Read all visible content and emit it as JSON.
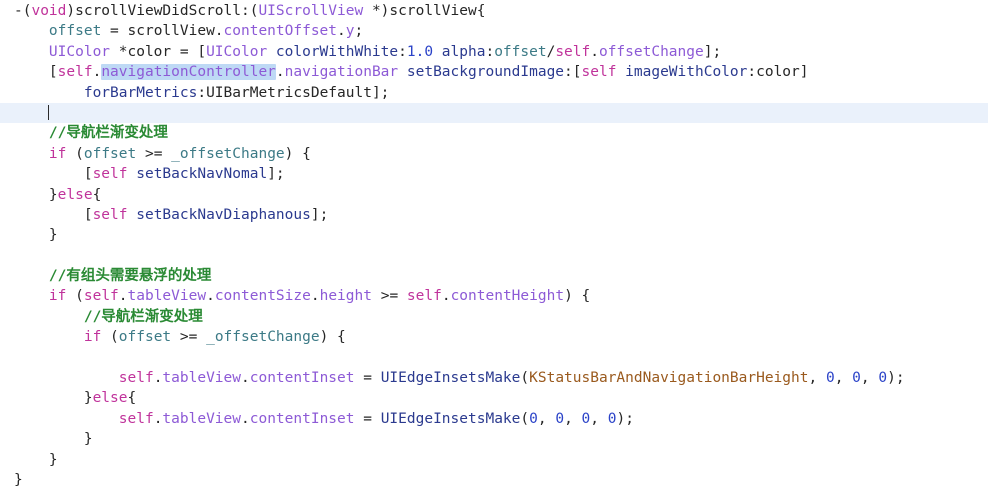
{
  "editor": {
    "language": "Objective-C",
    "background_color": "#ffffff",
    "current_line_highlight_color": "#eaf1fb",
    "selection_color": "#bed9f5",
    "caret_color": "#2a2a2a",
    "selected_text": "navigationController",
    "current_line_number": 6,
    "syntax_colors": {
      "keyword": "#c0339b",
      "class": "#8d5ad6",
      "property": "#8d5ad6",
      "variable": "#3c7a86",
      "message": "#2b3a8f",
      "number": "#2b43c8",
      "macro": "#9a5a1e",
      "comment": "#2a8a34",
      "plain": "#262626"
    }
  },
  "code": {
    "lines": [
      {
        "n": 1,
        "tokens": [
          {
            "t": "-(",
            "c": "plain"
          },
          {
            "t": "void",
            "c": "kw"
          },
          {
            "t": ")scrollViewDidScroll:(",
            "c": "plain"
          },
          {
            "t": "UIScrollView",
            "c": "class"
          },
          {
            "t": " *)scrollView{",
            "c": "plain"
          }
        ]
      },
      {
        "n": 2,
        "tokens": [
          {
            "t": "    ",
            "c": "plain"
          },
          {
            "t": "offset",
            "c": "var"
          },
          {
            "t": " = scrollView.",
            "c": "plain"
          },
          {
            "t": "contentOffset",
            "c": "prop"
          },
          {
            "t": ".",
            "c": "plain"
          },
          {
            "t": "y",
            "c": "prop"
          },
          {
            "t": ";",
            "c": "plain"
          }
        ]
      },
      {
        "n": 3,
        "tokens": [
          {
            "t": "    ",
            "c": "plain"
          },
          {
            "t": "UIColor",
            "c": "class"
          },
          {
            "t": " *color = [",
            "c": "plain"
          },
          {
            "t": "UIColor",
            "c": "class"
          },
          {
            "t": " ",
            "c": "plain"
          },
          {
            "t": "colorWithWhite",
            "c": "msg"
          },
          {
            "t": ":",
            "c": "plain"
          },
          {
            "t": "1.0",
            "c": "num"
          },
          {
            "t": " ",
            "c": "plain"
          },
          {
            "t": "alpha",
            "c": "msg"
          },
          {
            "t": ":",
            "c": "plain"
          },
          {
            "t": "offset",
            "c": "var"
          },
          {
            "t": "/",
            "c": "plain"
          },
          {
            "t": "self",
            "c": "kw"
          },
          {
            "t": ".",
            "c": "plain"
          },
          {
            "t": "offsetChange",
            "c": "prop"
          },
          {
            "t": "];",
            "c": "plain"
          }
        ]
      },
      {
        "n": 4,
        "tokens": [
          {
            "t": "    [",
            "c": "plain"
          },
          {
            "t": "self",
            "c": "kw"
          },
          {
            "t": ".",
            "c": "plain"
          },
          {
            "t": "navigationController",
            "c": "prop",
            "sel": true
          },
          {
            "t": ".",
            "c": "plain"
          },
          {
            "t": "navigationBar",
            "c": "prop"
          },
          {
            "t": " ",
            "c": "plain"
          },
          {
            "t": "setBackgroundImage",
            "c": "msg"
          },
          {
            "t": ":[",
            "c": "plain"
          },
          {
            "t": "self",
            "c": "kw"
          },
          {
            "t": " ",
            "c": "plain"
          },
          {
            "t": "imageWithColor",
            "c": "msg"
          },
          {
            "t": ":color]",
            "c": "plain"
          }
        ]
      },
      {
        "n": 5,
        "tokens": [
          {
            "t": "        ",
            "c": "plain"
          },
          {
            "t": "forBarMetrics",
            "c": "msg"
          },
          {
            "t": ":",
            "c": "plain"
          },
          {
            "t": "UIBarMetricsDefault",
            "c": "plain"
          },
          {
            "t": "];",
            "c": "plain"
          }
        ]
      },
      {
        "n": 6,
        "current": true,
        "caret_after": "    ",
        "tokens": [
          {
            "t": "    ",
            "c": "plain"
          }
        ]
      },
      {
        "n": 7,
        "tokens": [
          {
            "t": "    ",
            "c": "plain"
          },
          {
            "t": "//导航栏渐变处理",
            "c": "comment"
          }
        ]
      },
      {
        "n": 8,
        "tokens": [
          {
            "t": "    ",
            "c": "plain"
          },
          {
            "t": "if",
            "c": "kw"
          },
          {
            "t": " (",
            "c": "plain"
          },
          {
            "t": "offset",
            "c": "var"
          },
          {
            "t": " >= ",
            "c": "plain"
          },
          {
            "t": "_offsetChange",
            "c": "var"
          },
          {
            "t": ") {",
            "c": "plain"
          }
        ]
      },
      {
        "n": 9,
        "tokens": [
          {
            "t": "        [",
            "c": "plain"
          },
          {
            "t": "self",
            "c": "kw"
          },
          {
            "t": " ",
            "c": "plain"
          },
          {
            "t": "setBackNavNomal",
            "c": "msg"
          },
          {
            "t": "];",
            "c": "plain"
          }
        ]
      },
      {
        "n": 10,
        "tokens": [
          {
            "t": "    }",
            "c": "plain"
          },
          {
            "t": "else",
            "c": "kw"
          },
          {
            "t": "{",
            "c": "plain"
          }
        ]
      },
      {
        "n": 11,
        "tokens": [
          {
            "t": "        [",
            "c": "plain"
          },
          {
            "t": "self",
            "c": "kw"
          },
          {
            "t": " ",
            "c": "plain"
          },
          {
            "t": "setBackNavDiaphanous",
            "c": "msg"
          },
          {
            "t": "];",
            "c": "plain"
          }
        ]
      },
      {
        "n": 12,
        "tokens": [
          {
            "t": "    }",
            "c": "plain"
          }
        ]
      },
      {
        "n": 13,
        "tokens": []
      },
      {
        "n": 14,
        "tokens": [
          {
            "t": "    ",
            "c": "plain"
          },
          {
            "t": "//有组头需要悬浮的处理",
            "c": "comment"
          }
        ]
      },
      {
        "n": 15,
        "tokens": [
          {
            "t": "    ",
            "c": "plain"
          },
          {
            "t": "if",
            "c": "kw"
          },
          {
            "t": " (",
            "c": "plain"
          },
          {
            "t": "self",
            "c": "kw"
          },
          {
            "t": ".",
            "c": "plain"
          },
          {
            "t": "tableView",
            "c": "prop"
          },
          {
            "t": ".",
            "c": "plain"
          },
          {
            "t": "contentSize",
            "c": "prop"
          },
          {
            "t": ".",
            "c": "plain"
          },
          {
            "t": "height",
            "c": "prop"
          },
          {
            "t": " >= ",
            "c": "plain"
          },
          {
            "t": "self",
            "c": "kw"
          },
          {
            "t": ".",
            "c": "plain"
          },
          {
            "t": "contentHeight",
            "c": "prop"
          },
          {
            "t": ") {",
            "c": "plain"
          }
        ]
      },
      {
        "n": 16,
        "tokens": [
          {
            "t": "        ",
            "c": "plain"
          },
          {
            "t": "//导航栏渐变处理",
            "c": "comment"
          }
        ]
      },
      {
        "n": 17,
        "tokens": [
          {
            "t": "        ",
            "c": "plain"
          },
          {
            "t": "if",
            "c": "kw"
          },
          {
            "t": " (",
            "c": "plain"
          },
          {
            "t": "offset",
            "c": "var"
          },
          {
            "t": " >= ",
            "c": "plain"
          },
          {
            "t": "_offsetChange",
            "c": "var"
          },
          {
            "t": ") {",
            "c": "plain"
          }
        ]
      },
      {
        "n": 18,
        "tokens": []
      },
      {
        "n": 19,
        "tokens": [
          {
            "t": "            ",
            "c": "plain"
          },
          {
            "t": "self",
            "c": "kw"
          },
          {
            "t": ".",
            "c": "plain"
          },
          {
            "t": "tableView",
            "c": "prop"
          },
          {
            "t": ".",
            "c": "plain"
          },
          {
            "t": "contentInset",
            "c": "prop"
          },
          {
            "t": " = ",
            "c": "plain"
          },
          {
            "t": "UIEdgeInsetsMake",
            "c": "msg"
          },
          {
            "t": "(",
            "c": "plain"
          },
          {
            "t": "KStatusBarAndNavigationBarHeight",
            "c": "macro"
          },
          {
            "t": ", ",
            "c": "plain"
          },
          {
            "t": "0",
            "c": "num"
          },
          {
            "t": ", ",
            "c": "plain"
          },
          {
            "t": "0",
            "c": "num"
          },
          {
            "t": ", ",
            "c": "plain"
          },
          {
            "t": "0",
            "c": "num"
          },
          {
            "t": ");",
            "c": "plain"
          }
        ]
      },
      {
        "n": 20,
        "tokens": [
          {
            "t": "        }",
            "c": "plain"
          },
          {
            "t": "else",
            "c": "kw"
          },
          {
            "t": "{",
            "c": "plain"
          }
        ]
      },
      {
        "n": 21,
        "tokens": [
          {
            "t": "            ",
            "c": "plain"
          },
          {
            "t": "self",
            "c": "kw"
          },
          {
            "t": ".",
            "c": "plain"
          },
          {
            "t": "tableView",
            "c": "prop"
          },
          {
            "t": ".",
            "c": "plain"
          },
          {
            "t": "contentInset",
            "c": "prop"
          },
          {
            "t": " = ",
            "c": "plain"
          },
          {
            "t": "UIEdgeInsetsMake",
            "c": "msg"
          },
          {
            "t": "(",
            "c": "plain"
          },
          {
            "t": "0",
            "c": "num"
          },
          {
            "t": ", ",
            "c": "plain"
          },
          {
            "t": "0",
            "c": "num"
          },
          {
            "t": ", ",
            "c": "plain"
          },
          {
            "t": "0",
            "c": "num"
          },
          {
            "t": ", ",
            "c": "plain"
          },
          {
            "t": "0",
            "c": "num"
          },
          {
            "t": ");",
            "c": "plain"
          }
        ]
      },
      {
        "n": 22,
        "tokens": [
          {
            "t": "        }",
            "c": "plain"
          }
        ]
      },
      {
        "n": 23,
        "tokens": [
          {
            "t": "    }",
            "c": "plain"
          }
        ]
      },
      {
        "n": 24,
        "tokens": [
          {
            "t": "}",
            "c": "plain"
          }
        ]
      }
    ]
  }
}
